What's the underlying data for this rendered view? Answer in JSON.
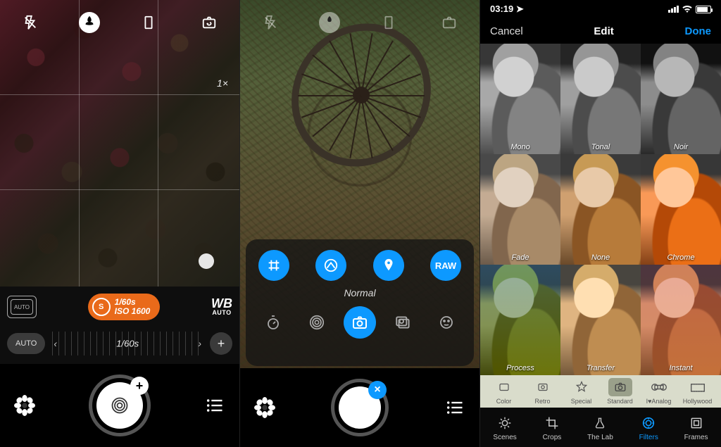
{
  "screen1": {
    "top_icons": [
      "flash",
      "macro",
      "aspect",
      "switch-camera"
    ],
    "zoom": "1×",
    "af_label": "AUTO",
    "exposure": {
      "badge": "S",
      "shutter": "1/60s",
      "iso": "ISO 1600"
    },
    "wb": {
      "main": "WB",
      "sub": "AUTO"
    },
    "auto_label": "AUTO",
    "dial_value": "1/60s",
    "dial_left": "‹",
    "dial_right": "›",
    "plus": "+",
    "shutter_badge": "+"
  },
  "screen2": {
    "top_icons": [
      "flash",
      "macro",
      "aspect",
      "switch-camera"
    ],
    "quick_row": [
      {
        "name": "grid",
        "label": "#"
      },
      {
        "name": "level",
        "label": ""
      },
      {
        "name": "location",
        "label": ""
      },
      {
        "name": "raw",
        "label": "RAW"
      }
    ],
    "mode_label": "Normal",
    "modes": [
      "timer",
      "stabilize",
      "photo",
      "burst",
      "face"
    ],
    "active_mode": "photo",
    "shutter_badge": "×"
  },
  "screen3": {
    "status": {
      "time": "03:19"
    },
    "nav": {
      "cancel": "Cancel",
      "title": "Edit",
      "done": "Done"
    },
    "filters": [
      {
        "name": "Mono",
        "cls": "bw"
      },
      {
        "name": "Tonal",
        "cls": "tonal"
      },
      {
        "name": "Noir",
        "cls": "noir"
      },
      {
        "name": "Fade",
        "cls": "fade"
      },
      {
        "name": "None",
        "cls": "none"
      },
      {
        "name": "Chrome",
        "cls": "chrome"
      },
      {
        "name": "Process",
        "cls": "process"
      },
      {
        "name": "Transfer",
        "cls": "transfer"
      },
      {
        "name": "Instant",
        "cls": "instant"
      }
    ],
    "categories": [
      {
        "name": "Color"
      },
      {
        "name": "Retro"
      },
      {
        "name": "Special"
      },
      {
        "name": "Standard",
        "active": true
      },
      {
        "name": "I♥Analog"
      },
      {
        "name": "Hollywood"
      }
    ],
    "tabs": [
      {
        "name": "Scenes"
      },
      {
        "name": "Crops"
      },
      {
        "name": "The Lab"
      },
      {
        "name": "Filters",
        "active": true
      },
      {
        "name": "Frames"
      }
    ]
  }
}
